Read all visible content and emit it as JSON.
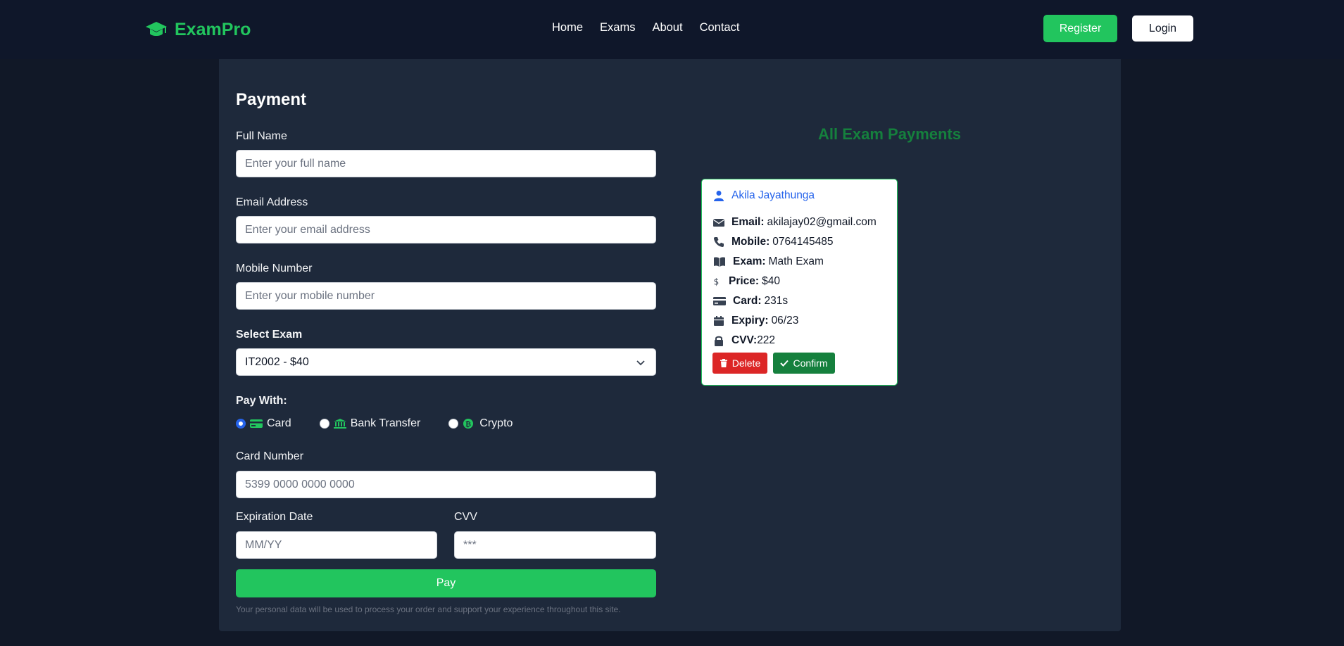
{
  "nav": {
    "brand": "ExamPro",
    "links": [
      "Home",
      "Exams",
      "About",
      "Contact"
    ],
    "register_label": "Register",
    "login_label": "Login"
  },
  "form": {
    "title": "Payment",
    "full_name": {
      "label": "Full Name",
      "placeholder": "Enter your full name"
    },
    "email": {
      "label": "Email Address",
      "placeholder": "Enter your email address"
    },
    "mobile": {
      "label": "Mobile Number",
      "placeholder": "Enter your mobile number"
    },
    "exam": {
      "label": "Select Exam",
      "selected": "IT2002 - $40"
    },
    "pay_with": {
      "label": "Pay With:",
      "options": [
        {
          "label": "Card",
          "icon": "credit-card-icon",
          "checked": true
        },
        {
          "label": "Bank Transfer",
          "icon": "bank-icon",
          "checked": false
        },
        {
          "label": "Crypto",
          "icon": "bitcoin-icon",
          "checked": false
        }
      ]
    },
    "card_number": {
      "label": "Card Number",
      "placeholder": "5399 0000 0000 0000"
    },
    "expiry": {
      "label": "Expiration Date",
      "placeholder": "MM/YY"
    },
    "cvv": {
      "label": "CVV",
      "placeholder": "***"
    },
    "pay_label": "Pay",
    "disclaimer": "Your personal data will be used to process your order and support your experience throughout this site."
  },
  "payments": {
    "title": "All Exam Payments",
    "items": [
      {
        "name": "Akila Jayathunga",
        "email_label": "Email:",
        "email": "akilajay02@gmail.com",
        "mobile_label": "Mobile:",
        "mobile": "0764145485",
        "exam_label": "Exam:",
        "exam": "Math Exam",
        "price_label": "Price:",
        "price": "$40",
        "card_label": "Card:",
        "card": "231s",
        "expiry_label": "Expiry:",
        "expiry": "06/23",
        "cvv_label": "CVV:",
        "cvv": "222",
        "delete_label": "Delete",
        "confirm_label": "Confirm"
      }
    ]
  },
  "colors": {
    "accent": "#22c55e",
    "background": "#111827",
    "panel": "#1e293b",
    "danger": "#dc2626",
    "confirm": "#15803d",
    "link": "#2563eb"
  }
}
